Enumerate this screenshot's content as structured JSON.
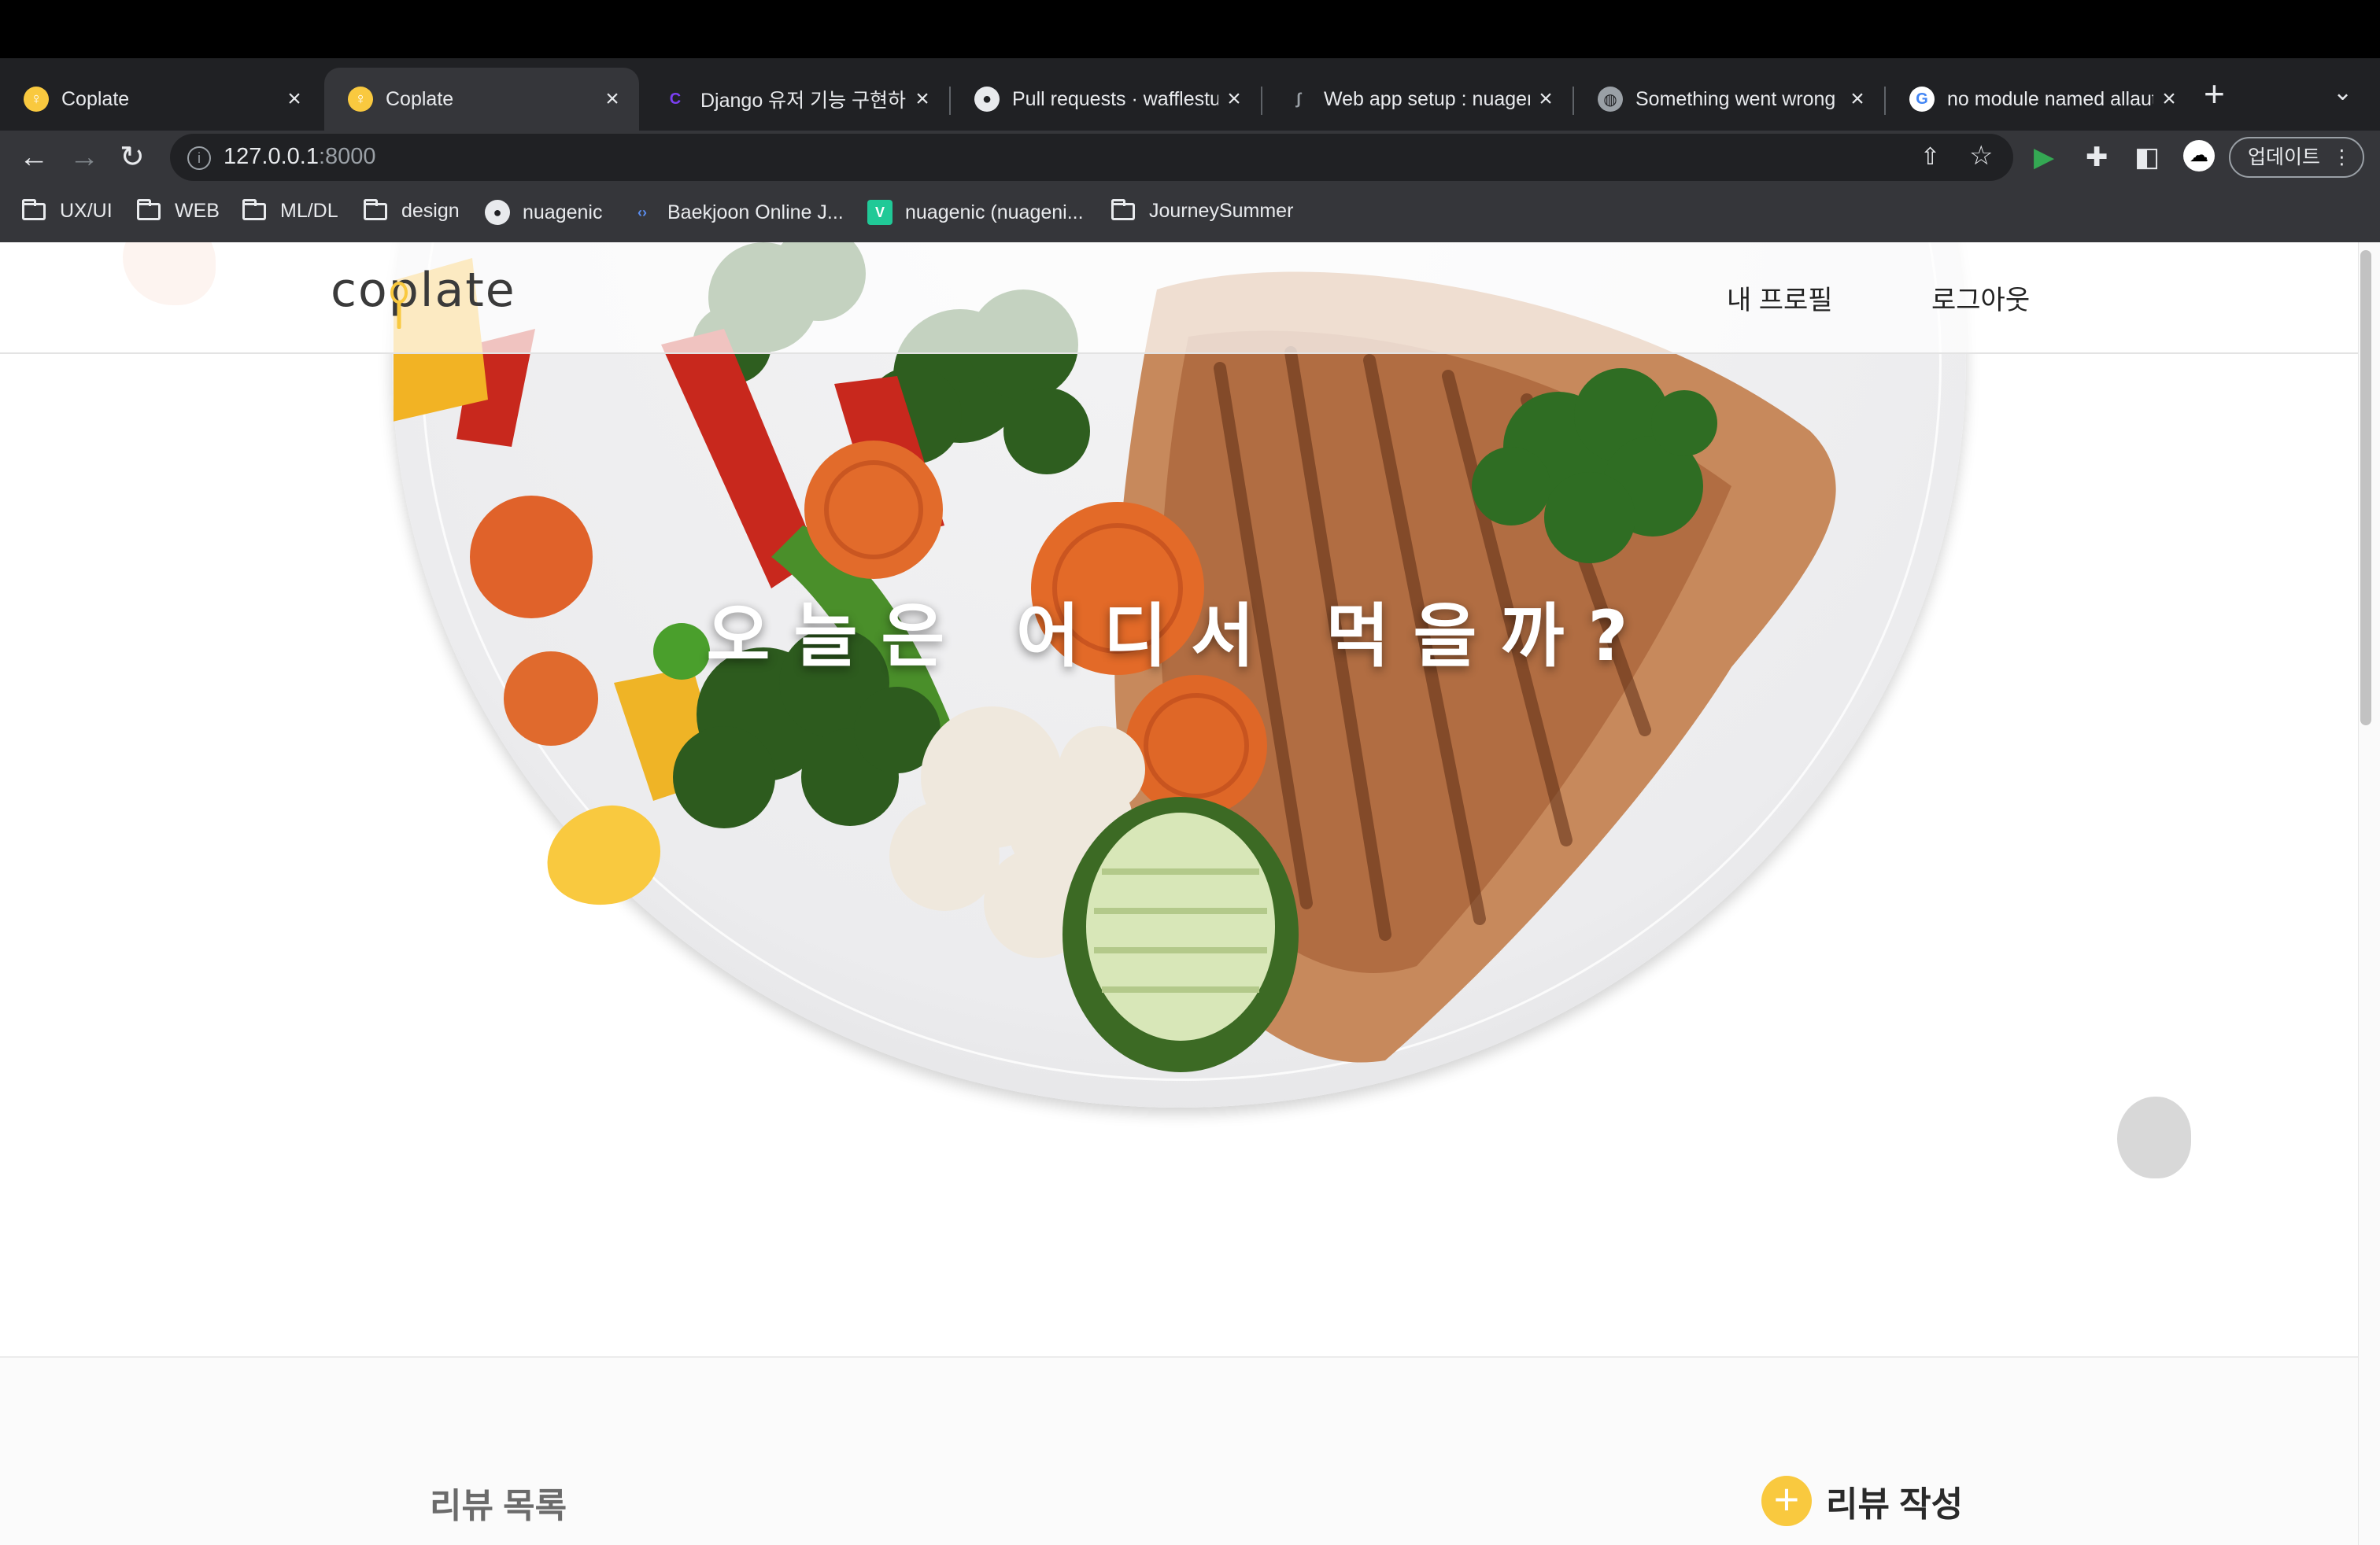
{
  "browser": {
    "tabs": [
      {
        "title": "Coplate",
        "favicon": "coplate-icon",
        "active": false
      },
      {
        "title": "Coplate",
        "favicon": "coplate-icon",
        "active": true
      },
      {
        "title": "Django 유저 기능 구현하기",
        "favicon": "gitbook-icon",
        "active": false
      },
      {
        "title": "Pull requests · wafflestu",
        "favicon": "github-icon",
        "active": false
      },
      {
        "title": "Web app setup : nuagen",
        "favicon": "pythonanywhere-icon",
        "active": false
      },
      {
        "title": "Something went wrong",
        "favicon": "globe-icon",
        "active": false
      },
      {
        "title": "no module named allaut",
        "favicon": "google-icon",
        "active": false
      }
    ],
    "address": {
      "host": "127.0.0.1",
      "port": ":8000"
    },
    "update_button": "업데이트",
    "bookmarks": [
      {
        "label": "UX/UI",
        "icon": "folder-icon"
      },
      {
        "label": "WEB",
        "icon": "folder-icon"
      },
      {
        "label": "ML/DL",
        "icon": "folder-icon"
      },
      {
        "label": "design",
        "icon": "folder-icon"
      },
      {
        "label": "nuagenic",
        "icon": "github-icon"
      },
      {
        "label": "Baekjoon Online J...",
        "icon": "code-icon"
      },
      {
        "label": "nuagenic (nuageni...",
        "icon": "velog-icon"
      },
      {
        "label": "JourneySummer",
        "icon": "folder-icon"
      }
    ],
    "colors": {
      "tab_strip": "#202124",
      "toolbar": "#35363a",
      "accent_green": "#34a853"
    }
  },
  "site": {
    "logo": "coplate",
    "nav": {
      "profile": "내 프로필",
      "logout": "로그아웃"
    },
    "hero": {
      "title": "오늘은 어디서 먹을까?"
    },
    "reviews": {
      "title": "리뷰 목록",
      "add_label": "리뷰 작성"
    },
    "colors": {
      "brand_yellow": "#f9c93f",
      "text_dark": "#2a2a2a"
    }
  }
}
